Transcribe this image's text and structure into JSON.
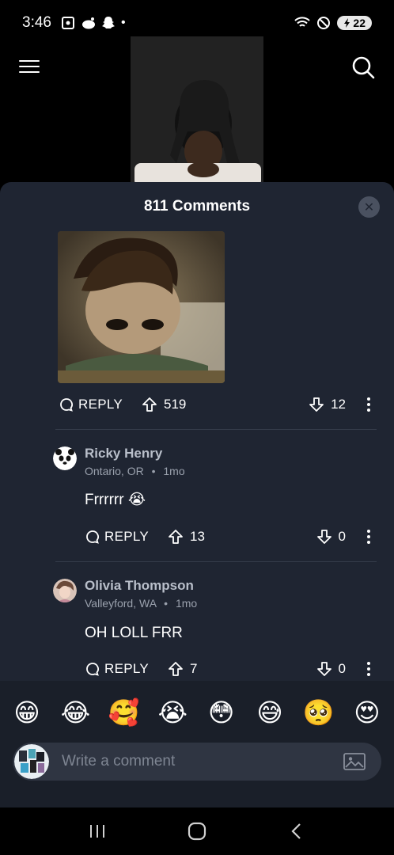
{
  "status_bar": {
    "time": "3:46",
    "battery": "22",
    "dot": "•"
  },
  "header": {
    "menu_icon": "menu-icon",
    "search_icon": "search-icon"
  },
  "comments_sheet": {
    "title": "811 Comments",
    "close_icon": "close-icon",
    "top_comment": {
      "reply_label": "REPLY",
      "upvotes": "519",
      "downvotes": "12"
    },
    "replies": [
      {
        "name": "Ricky Henry",
        "location": "Ontario, OR",
        "separator": "•",
        "age": "1mo",
        "text": "Frrrrrr 😭",
        "reply_label": "REPLY",
        "upvotes": "13",
        "downvotes": "0"
      },
      {
        "name": "Olivia Thompson",
        "location": "Valleyford, WA",
        "separator": "•",
        "age": "1mo",
        "text": "OH LOLL FRR",
        "reply_label": "REPLY",
        "upvotes": "7",
        "downvotes": "0"
      }
    ]
  },
  "emoji_bar": [
    "😁",
    "😂",
    "🥰",
    "😭",
    "😳",
    "😅",
    "🥺",
    "😍"
  ],
  "composer": {
    "placeholder": "Write a comment",
    "image_icon": "image-icon"
  },
  "nav": {
    "recents_icon": "recents-icon",
    "home_icon": "home-icon",
    "back_icon": "back-icon"
  },
  "colors": {
    "sheet_bg": "#1f2532",
    "input_bg": "#2f3542",
    "name_color": "#b9bfca"
  }
}
